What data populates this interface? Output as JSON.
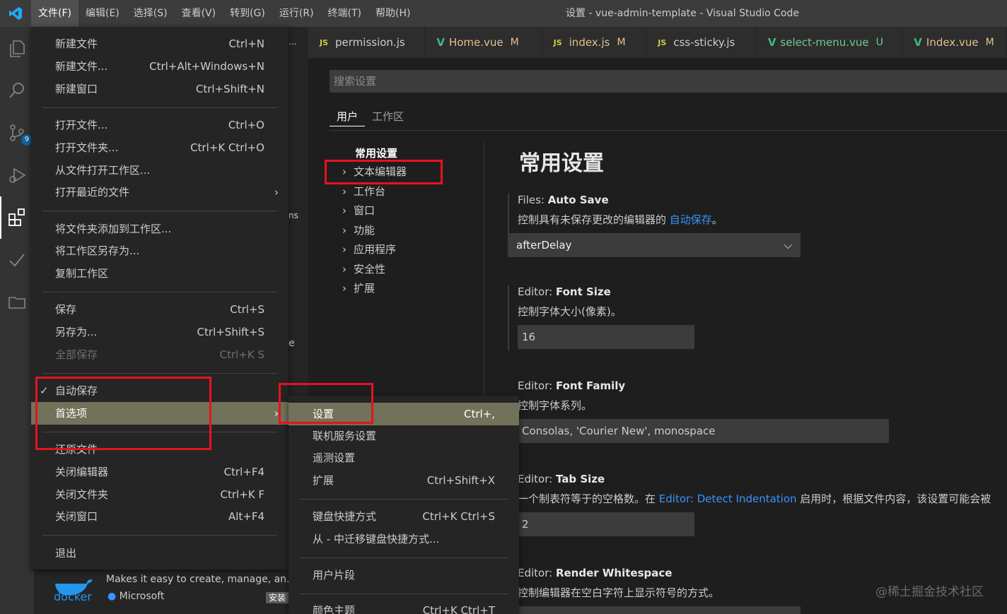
{
  "window_title": "设置 - vue-admin-template - Visual Studio Code",
  "menubar": [
    "文件(F)",
    "编辑(E)",
    "选择(S)",
    "查看(V)",
    "转到(G)",
    "运行(R)",
    "终端(T)",
    "帮助(H)"
  ],
  "activity": {
    "scm_badge": "9"
  },
  "tabs": [
    {
      "icon": "JS",
      "name": "permission.js",
      "status": ""
    },
    {
      "icon": "V",
      "name": "Home.vue",
      "status": "M"
    },
    {
      "icon": "JS",
      "name": "index.js",
      "status": "M"
    },
    {
      "icon": "JS",
      "name": "css-sticky.js",
      "status": ""
    },
    {
      "icon": "V",
      "name": "select-menu.vue",
      "status": "U"
    },
    {
      "icon": "V",
      "name": "Index.vue",
      "status": "M"
    }
  ],
  "settings": {
    "search_placeholder": "搜索设置",
    "scope_tabs": [
      "用户",
      "工作区"
    ],
    "toc_header": "常用设置",
    "toc_items": [
      "文本编辑器",
      "工作台",
      "窗口",
      "功能",
      "应用程序",
      "安全性",
      "扩展"
    ],
    "section_title": "常用设置",
    "items": [
      {
        "cat": "Files: ",
        "name": "Auto Save",
        "desc": "控制具有未保存更改的编辑器的 ",
        "link": "自动保存",
        "desc_after": "。",
        "value": "afterDelay"
      },
      {
        "cat": "Editor: ",
        "name": "Font Size",
        "desc": "控制字体大小(像素)。",
        "value": "16"
      },
      {
        "cat": "Editor: ",
        "name": "Font Family",
        "desc": "控制字体系列。",
        "value": "Consolas, 'Courier New', monospace"
      },
      {
        "cat": "Editor: ",
        "name": "Tab Size",
        "desc": "一个制表符等于的空格数。在 ",
        "link": "Editor: Detect Indentation",
        "desc_after": " 启用时，根据文件内容，该设置可能会被",
        "value": "2"
      },
      {
        "cat": "Editor: ",
        "name": "Render Whitespace",
        "desc": "控制编辑器在空白字符上显示符号的方式。"
      }
    ]
  },
  "file_menu": [
    {
      "label": "新建文件",
      "key": "Ctrl+N"
    },
    {
      "label": "新建文件...",
      "key": "Ctrl+Alt+Windows+N"
    },
    {
      "label": "新建窗口",
      "key": "Ctrl+Shift+N"
    },
    {
      "label": "打开文件...",
      "key": "Ctrl+O"
    },
    {
      "label": "打开文件夹...",
      "key": "Ctrl+K Ctrl+O"
    },
    {
      "label": "从文件打开工作区...",
      "key": ""
    },
    {
      "label": "打开最近的文件",
      "key": ""
    },
    {
      "label": "将文件夹添加到工作区...",
      "key": ""
    },
    {
      "label": "将工作区另存为...",
      "key": ""
    },
    {
      "label": "复制工作区",
      "key": ""
    },
    {
      "label": "保存",
      "key": "Ctrl+S"
    },
    {
      "label": "另存为...",
      "key": "Ctrl+Shift+S"
    },
    {
      "label": "全部保存",
      "key": "Ctrl+K S"
    },
    {
      "label": "自动保存",
      "key": ""
    },
    {
      "label": "首选项",
      "key": ""
    },
    {
      "label": "还原文件",
      "key": ""
    },
    {
      "label": "关闭编辑器",
      "key": "Ctrl+F4"
    },
    {
      "label": "关闭文件夹",
      "key": "Ctrl+K F"
    },
    {
      "label": "关闭窗口",
      "key": "Alt+F4"
    },
    {
      "label": "退出",
      "key": ""
    }
  ],
  "pref_menu": [
    {
      "label": "设置",
      "key": "Ctrl+,"
    },
    {
      "label": "联机服务设置",
      "key": ""
    },
    {
      "label": "遥测设置",
      "key": ""
    },
    {
      "label": "扩展",
      "key": "Ctrl+Shift+X"
    },
    {
      "label": "键盘快捷方式",
      "key": "Ctrl+K Ctrl+S"
    },
    {
      "label": "从 - 中迁移键盘快捷方式...",
      "key": ""
    },
    {
      "label": "用户片段",
      "key": ""
    },
    {
      "label": "颜色主题",
      "key": "Ctrl+K Ctrl+T"
    }
  ],
  "extension": {
    "name": "docker",
    "description": "Makes it easy to create, manage, an...",
    "publisher": "Microsoft",
    "install": "安装"
  },
  "sidebar_fragments": [
    "...",
    "ns",
    "e"
  ],
  "watermark": "@稀土掘金技术社区",
  "colors": {
    "accent": "#007acc",
    "highlight": "#72715a",
    "annotation": "#e8121e",
    "link": "#3794ff"
  }
}
